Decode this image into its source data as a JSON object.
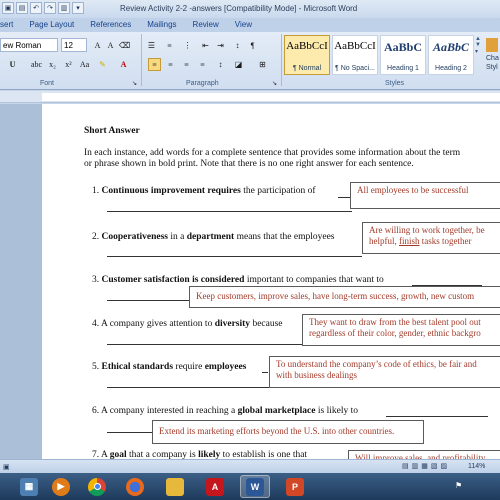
{
  "window": {
    "title": "Review Activity 2-2 -answers [Compatibility Mode] - Microsoft Word"
  },
  "tabs": [
    "sert",
    "Page Layout",
    "References",
    "Mailings",
    "Review",
    "View"
  ],
  "ribbon": {
    "font_name": "ew Roman",
    "font_size": "12",
    "groups": {
      "font": "Font",
      "paragraph": "Paragraph",
      "styles": "Styles"
    },
    "styles": [
      {
        "preview": "AaBbCcI",
        "name": "¶ Normal"
      },
      {
        "preview": "AaBbCcI",
        "name": "¶ No Spaci..."
      },
      {
        "preview": "AaBbC",
        "name": "Heading 1"
      },
      {
        "preview": "AaBbC",
        "name": "Heading 2"
      }
    ],
    "change_styles": "Cha\nStyl"
  },
  "document": {
    "heading": "Short Answer",
    "instructions_1": "In each instance, add words for a complete sentence that provides some information about the term",
    "instructions_2": "or phrase shown in bold print. Note that there is no one right answer for each sentence.",
    "q1": {
      "num": "1.",
      "b1": "Continuous improvement requires",
      "t1": " the participation of",
      "answer": "All employees to be successful"
    },
    "q2": {
      "num": "2.",
      "b1": "Cooperativeness",
      "t1": " in a ",
      "b2": "department",
      "t2": " means that the employees",
      "answer_1": "Are willing to work together, be",
      "answer_2a": "helpful, ",
      "answer_2b": "finish",
      "answer_2c": " tasks together"
    },
    "q3": {
      "num": "3.",
      "b1": "Customer satisfaction is considered",
      "t1": " important to companies that want to",
      "answer": "Keep customers, improve sales, have long-term success, growth, new custom"
    },
    "q4": {
      "num": "4.",
      "t1": "A company gives attention to ",
      "b1": "diversity",
      "t2": " because",
      "answer_1": "They want to draw from the best talent pool out",
      "answer_2": "regardless of their color, gender, ethnic backgro"
    },
    "q5": {
      "num": "5.",
      "b1": "Ethical standards",
      "t1": " require ",
      "b2": "employees",
      "answer_1": "To understand the company’s code of ethics, be fair and",
      "answer_2": "with business dealings"
    },
    "q6": {
      "num": "6.",
      "t1": "A company interested in reaching a ",
      "b1": "global marketplace",
      "t2": " is likely to",
      "answer": "Extend its marketing efforts beyond the U.S. into other countries."
    },
    "q7": {
      "num": "7.",
      "t1": "A ",
      "b1": "goal",
      "t2": " that a company is ",
      "b2": "likely",
      "t3": " to establish is one that",
      "answer": "Will improve sales, and profitability"
    }
  },
  "status": {
    "zoom": "114%"
  },
  "taskbar": {
    "apps": [
      "explorer-icon",
      "media-player-icon",
      "chrome-icon",
      "firefox-icon",
      "folder-icon",
      "acrobat-icon",
      "word-icon",
      "powerpoint-icon"
    ]
  }
}
